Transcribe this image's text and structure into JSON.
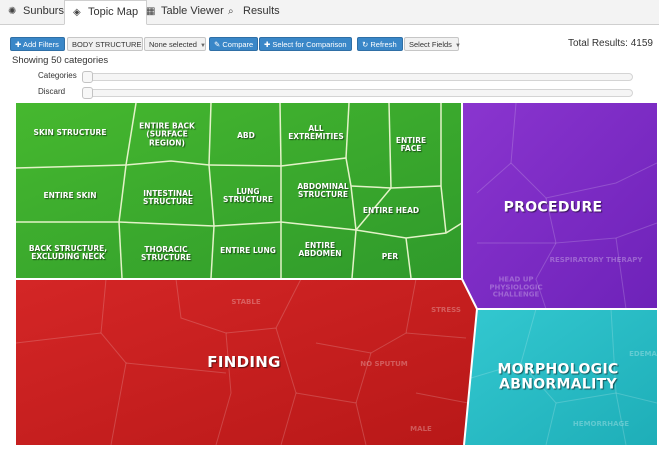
{
  "tabs": [
    {
      "label": "Sunburst",
      "icon": "sunburst-icon",
      "glyph": "✺",
      "active": false
    },
    {
      "label": "Topic Map",
      "icon": "tag-icon",
      "glyph": "◈",
      "active": true
    },
    {
      "label": "Table Viewer",
      "icon": "table-icon",
      "glyph": "▦",
      "active": false
    },
    {
      "label": "Results",
      "icon": "search-icon",
      "glyph": "⌕",
      "active": false
    }
  ],
  "toolbar": {
    "add_filters": "Add Filters",
    "body_structure": "BODY STRUCTURE",
    "none_selected": "None selected",
    "compare": "Compare",
    "select_for_comparison": "Select for Comparison",
    "refresh": "Refresh",
    "select_fields": "Select Fields"
  },
  "total_results": "Total Results: 4159",
  "showing": "Showing 50 categories",
  "sliders": {
    "categories_label": "Categories",
    "discard_label": "Discard"
  },
  "treemap": {
    "groups": [
      {
        "name": "BODY STRUCTURE",
        "color": "#3aa12b",
        "cells": [
          "SKIN STRUCTURE",
          "ENTIRE BACK (SURFACE REGION)",
          "ABD",
          "ALL EXTREMITIES",
          "ENTIRE FACE",
          "ENTIRE SKIN",
          "INTESTINAL STRUCTURE",
          "LUNG STRUCTURE",
          "ABDOMINAL STRUCTURE",
          "ENTIRE HEAD",
          "BACK STRUCTURE, EXCLUDING NECK",
          "THORACIC STRUCTURE",
          "ENTIRE LUNG",
          "ENTIRE ABDOMEN",
          "PER"
        ]
      },
      {
        "name": "PROCEDURE",
        "color": "#7d28c4"
      },
      {
        "name": "FINDING",
        "color": "#c81e1e"
      },
      {
        "name": "MORPHOLOGIC ABNORMALITY",
        "color": "#24bfc8"
      }
    ],
    "faint_labels": [
      "RESPIRATORY THERAPY",
      "HEAD UP PHYSIOLOGIC CHALLENGE",
      "STABLE",
      "NO SPUTUM",
      "STRESS",
      "MALE",
      "HEMORRHAGE",
      "EDEMA"
    ]
  }
}
